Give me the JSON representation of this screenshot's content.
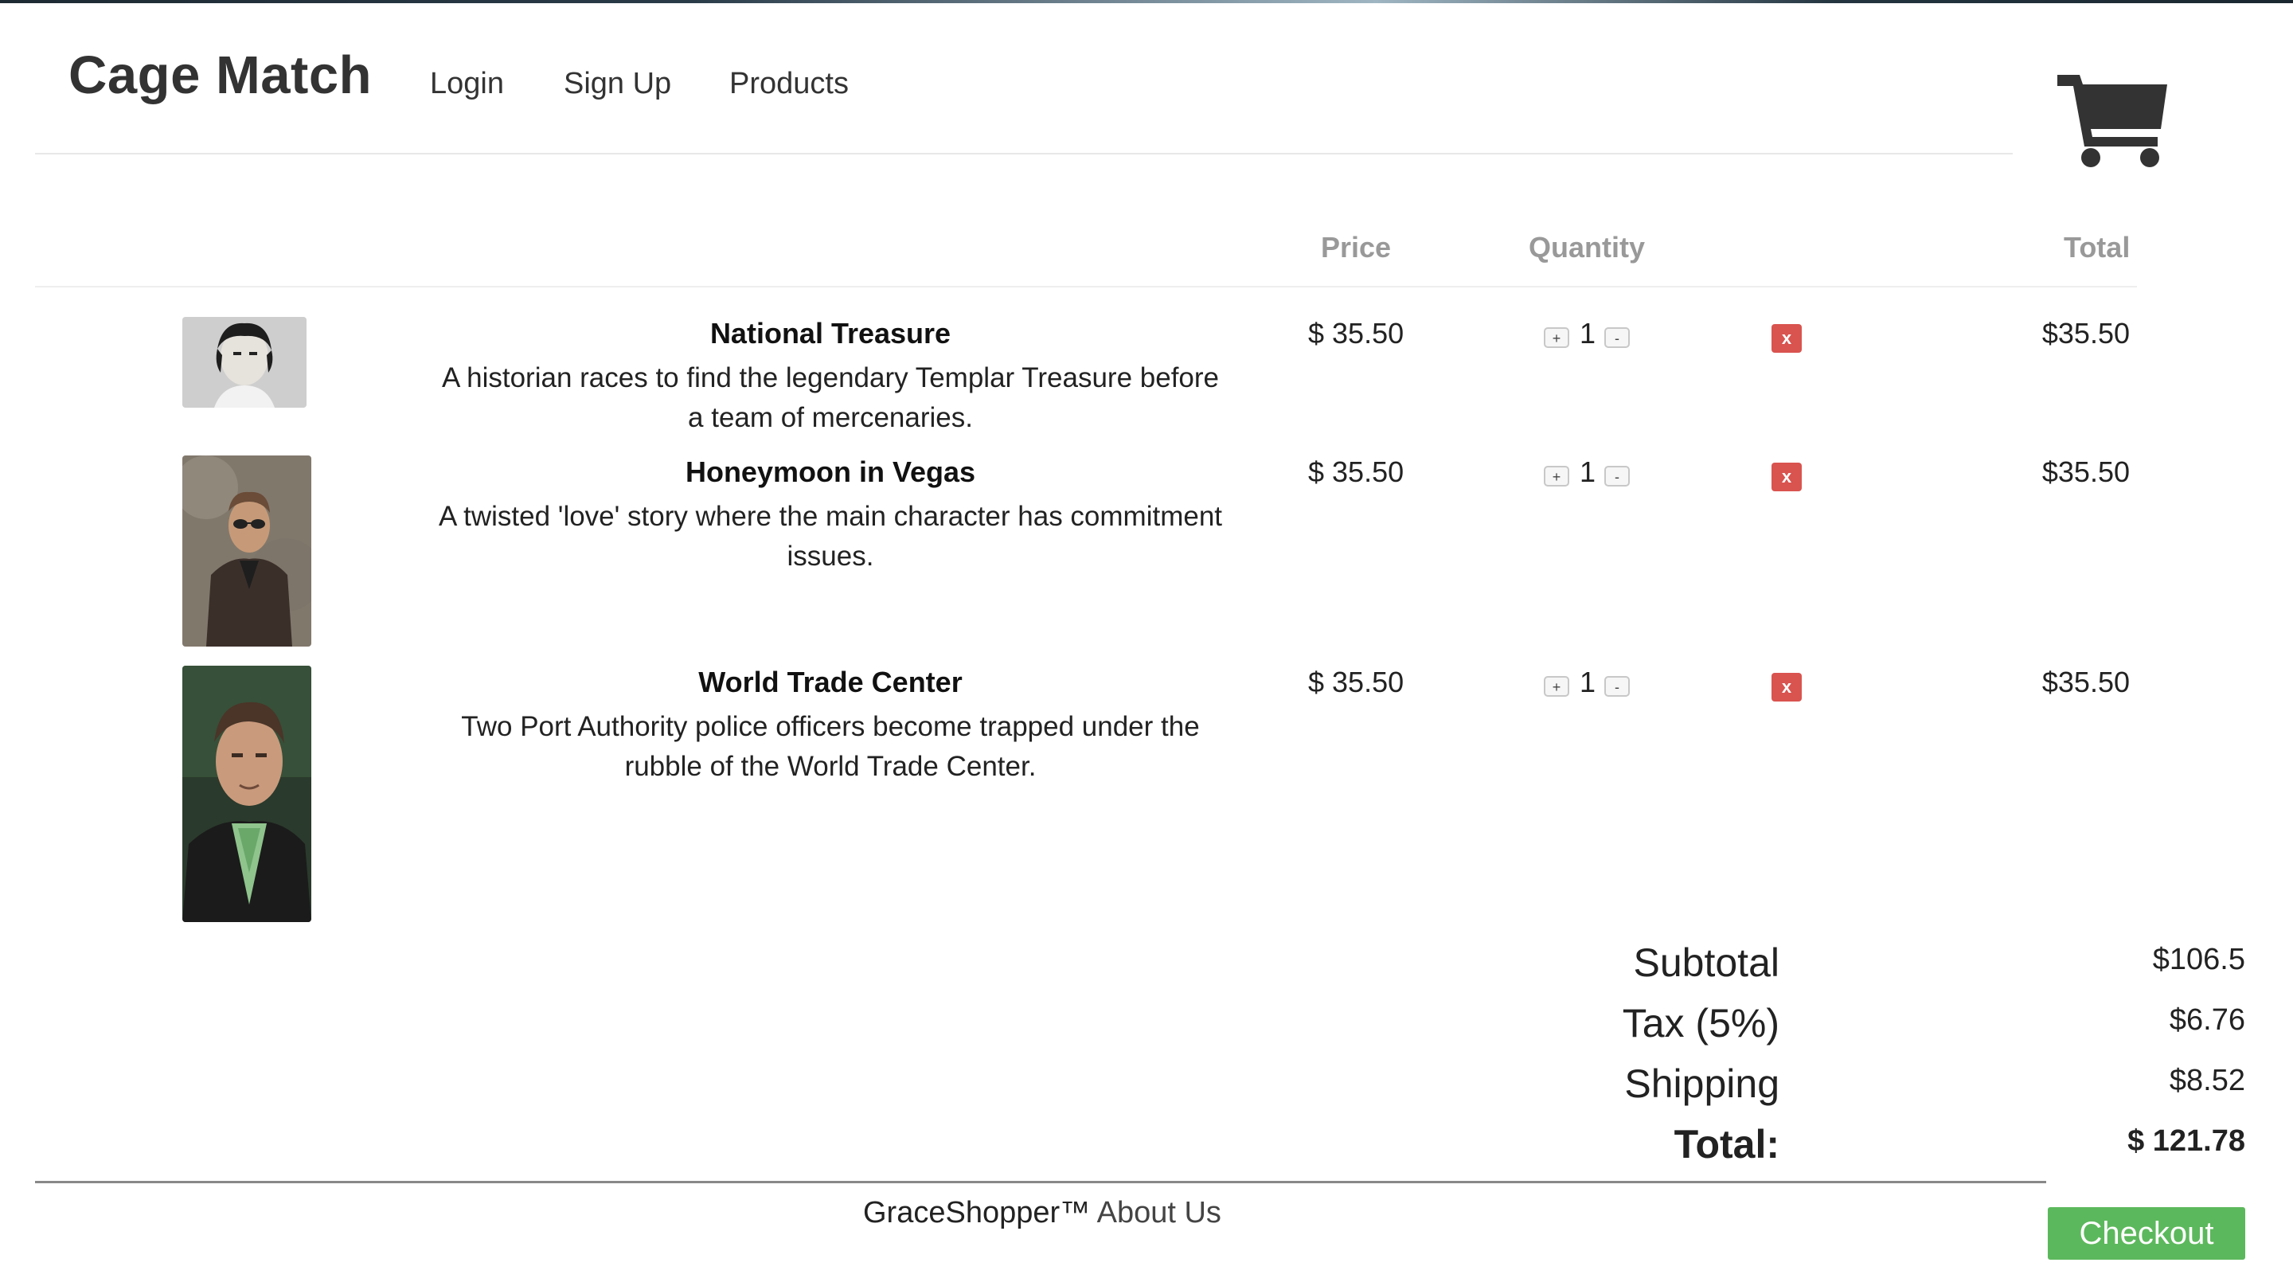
{
  "brand": "Cage Match",
  "nav": {
    "login": "Login",
    "signup": "Sign Up",
    "products": "Products"
  },
  "icons": {
    "cart": "shopping-cart-icon",
    "increment": "plus-icon",
    "decrement": "minus-icon",
    "remove": "remove-x-icon"
  },
  "table": {
    "headers": {
      "price": "Price",
      "quantity": "Quantity",
      "total": "Total"
    }
  },
  "cart_items": [
    {
      "title": "National Treasure",
      "description": "A historian races to find the legendary Templar Treasure before a team of mercenaries.",
      "price": "$ 35.50",
      "quantity": "1",
      "total": "$35.50",
      "plus_label": "+",
      "minus_label": "-",
      "remove_label": "x"
    },
    {
      "title": "Honeymoon in Vegas",
      "description": "A twisted 'love' story where the main character has commitment issues.",
      "price": "$ 35.50",
      "quantity": "1",
      "total": "$35.50",
      "plus_label": "+",
      "minus_label": "-",
      "remove_label": "x"
    },
    {
      "title": "World Trade Center",
      "description": "Two Port Authority police officers become trapped under the rubble of the World Trade Center.",
      "price": "$ 35.50",
      "quantity": "1",
      "total": "$35.50",
      "plus_label": "+",
      "minus_label": "-",
      "remove_label": "x"
    }
  ],
  "summary": {
    "subtotal_label": "Subtotal",
    "subtotal_value": "$106.5",
    "tax_label": "Tax (5%)",
    "tax_value": "$6.76",
    "shipping_label": "Shipping",
    "shipping_value": "$8.52",
    "total_label": "Total:",
    "total_value": "$ 121.78"
  },
  "footer": {
    "brand": "GraceShopper™",
    "about": "About Us"
  },
  "checkout_label": "Checkout",
  "colors": {
    "checkout": "#5cb85c",
    "remove": "#d9534f",
    "header_gray": "#999999"
  }
}
